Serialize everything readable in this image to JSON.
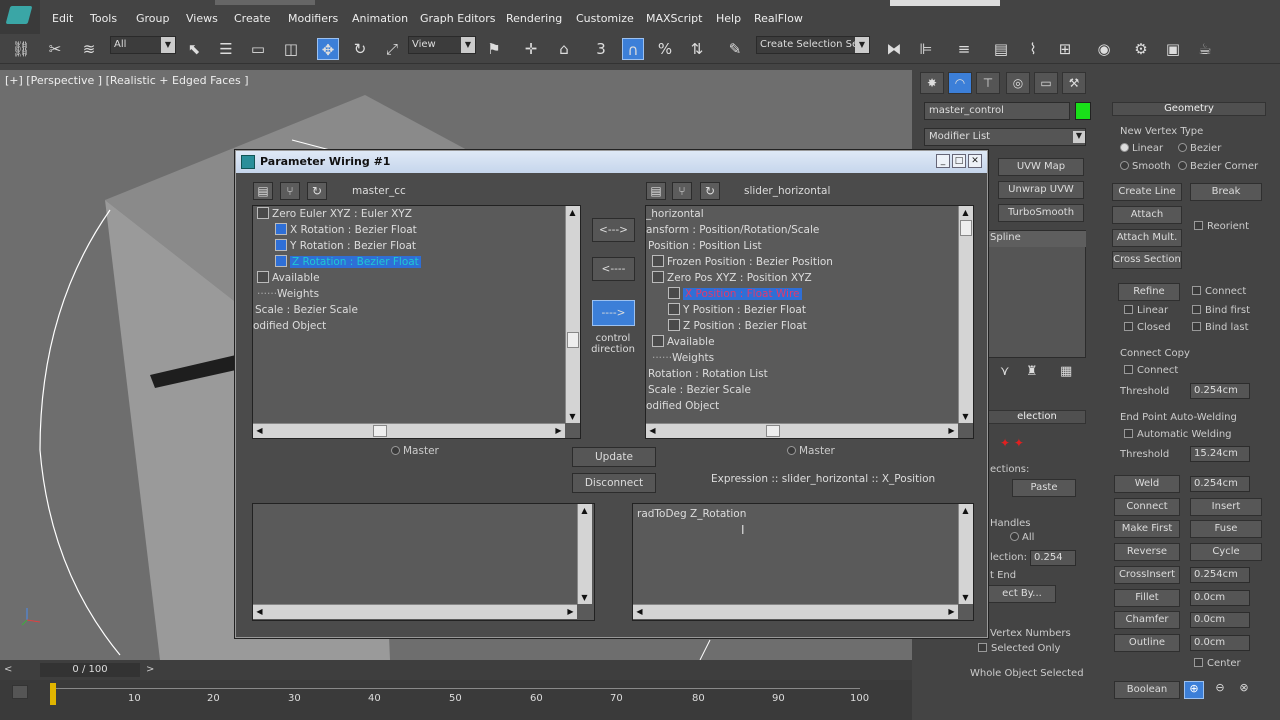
{
  "menu": {
    "items": [
      "Edit",
      "Tools",
      "Group",
      "Views",
      "Create",
      "Modifiers",
      "Animation",
      "Graph Editors",
      "Rendering",
      "Customize",
      "MAXScript",
      "Help",
      "RealFlow"
    ]
  },
  "toolbar": {
    "selection_filter": "All",
    "ref_coord": "View",
    "named_selection": "Create Selection Se",
    "snap_value": "3"
  },
  "viewport": {
    "label": "[+] [Perspective ] [Realistic + Edged Faces ]"
  },
  "timeline": {
    "frame": "0 / 100",
    "ticks": [
      "10",
      "20",
      "30",
      "40",
      "50",
      "60",
      "70",
      "80",
      "90",
      "100"
    ]
  },
  "command_panel": {
    "object_name": "master_control",
    "object_color": "#19e019",
    "modifier_list": "Modifier List",
    "modifier_buttons": [
      "UVW Map",
      "Unwrap UVW",
      "TurboSmooth"
    ],
    "stack_item": "Spline",
    "selection_header": "election",
    "geometry_header": "Geometry",
    "new_vertex_type": "New Vertex Type",
    "vt_linear": "Linear",
    "vt_bezier": "Bezier",
    "vt_smooth": "Smooth",
    "vt_bezier_corner": "Bezier Corner",
    "create_line": "Create Line",
    "break": "Break",
    "attach": "Attach",
    "reorient": "Reorient",
    "attach_mult": "Attach Mult.",
    "cross_section": "Cross Section",
    "refine": "Refine",
    "connect": "Connect",
    "linear": "Linear",
    "bind_first": "Bind first",
    "closed": "Closed",
    "bind_last": "Bind last",
    "connect_copy": "Connect Copy",
    "connect_cb": "Connect",
    "threshold": "Threshold",
    "threshold_value1": "0.254cm",
    "end_point_auto_welding": "End Point Auto-Welding",
    "automatic_welding": "Automatic Welding",
    "threshold_value2": "15.24cm",
    "weld": "Weld",
    "weld_value": "0.254cm",
    "connect_btn": "Connect",
    "insert": "Insert",
    "make_first": "Make First",
    "fuse": "Fuse",
    "reverse": "Reverse",
    "cycle": "Cycle",
    "crossinsert": "CrossInsert",
    "crossinsert_value": "0.254cm",
    "fillet": "Fillet",
    "fillet_value": "0.0cm",
    "chamfer": "Chamfer",
    "chamfer_value": "0.0cm",
    "outline": "Outline",
    "outline_value": "0.0cm",
    "center": "Center",
    "boolean": "Boolean",
    "mid_copy_paste_label": "ections:",
    "paste": "Paste",
    "handles": "Handles",
    "all": "All",
    "selection_label": "lection:",
    "selection_value": "0.254",
    "end_label": "t End",
    "select_by": "ect By...",
    "vertex_numbers": "Vertex Numbers",
    "selected_only": "Selected Only",
    "whole_object_selected": "Whole Object Selected"
  },
  "dialog": {
    "title": "Parameter Wiring #1",
    "left_header": "master_cc",
    "right_header": "slider_horizontal",
    "left_tree": [
      "Zero Euler XYZ : Euler XYZ",
      "X Rotation : Bezier Float",
      "Y Rotation : Bezier Float",
      "Z Rotation : Bezier Float",
      "Available",
      "Weights",
      "Scale : Bezier Scale",
      "odified Object"
    ],
    "right_tree": [
      "_horizontal",
      "ansform : Position/Rotation/Scale",
      "Position : Position List",
      "Frozen Position : Bezier Position",
      "Zero Pos XYZ : Position XYZ",
      "X Position : Float Wire",
      "Y Position : Bezier Float",
      "Z Position : Bezier Float",
      "Available",
      "Weights",
      "Rotation : Rotation List",
      "Scale : Bezier Scale",
      "odified Object"
    ],
    "btn_both": "<--->",
    "btn_left": "<----",
    "btn_right": "---->",
    "control_direction": "control direction",
    "master_left": "Master",
    "master_right": "Master",
    "update": "Update",
    "disconnect": "Disconnect",
    "expression_label": "Expression :: slider_horizontal :: X_Position",
    "left_expression": "",
    "right_expression": "radToDeg Z_Rotation"
  }
}
